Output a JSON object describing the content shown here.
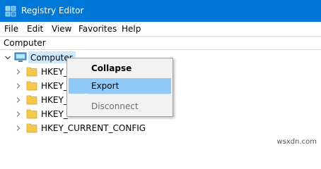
{
  "window": {
    "title": "Registry Editor",
    "accent": "#0078d7"
  },
  "menu": [
    "File",
    "Edit",
    "View",
    "Favorites",
    "Help"
  ],
  "address": {
    "path": "Computer"
  },
  "tree": {
    "root": "Computer",
    "items": [
      "HKEY_C",
      "HKEY_C",
      "HKEY_L",
      "HKEY_U",
      "HKEY_CURRENT_CONFIG"
    ]
  },
  "context_menu": {
    "items": [
      {
        "label": "Collapse",
        "state": "default-bold"
      },
      {
        "label": "Export",
        "state": "highlighted"
      },
      {
        "label": "Disconnect",
        "state": "disabled"
      }
    ]
  },
  "watermark": "wsxdn.com",
  "icons": {
    "app": "registry-editor-icon",
    "root": "computer-icon",
    "folder": "folder-icon",
    "expand": "chevron-right-icon",
    "collapse": "chevron-down-icon"
  }
}
